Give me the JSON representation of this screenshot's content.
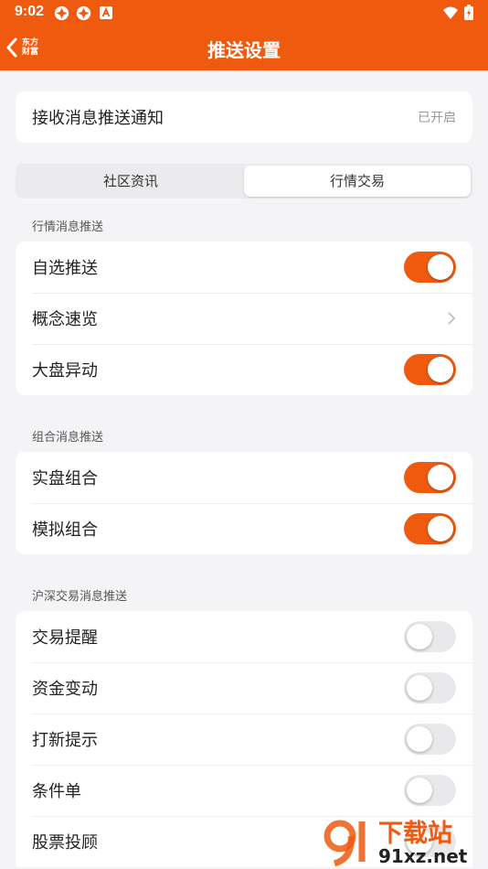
{
  "status_bar": {
    "time": "9:02"
  },
  "nav": {
    "back_logo_line1": "东方",
    "back_logo_line2": "财富",
    "title": "推送设置"
  },
  "receive": {
    "label": "接收消息推送通知",
    "value": "已开启"
  },
  "tabs": [
    {
      "label": "社区资讯",
      "active": false
    },
    {
      "label": "行情交易",
      "active": true
    }
  ],
  "sections": [
    {
      "title": "行情消息推送",
      "rows": [
        {
          "label": "自选推送",
          "control": "toggle",
          "on": true
        },
        {
          "label": "概念速览",
          "control": "chevron"
        },
        {
          "label": "大盘异动",
          "control": "toggle",
          "on": true
        }
      ]
    },
    {
      "title": "组合消息推送",
      "rows": [
        {
          "label": "实盘组合",
          "control": "toggle",
          "on": true
        },
        {
          "label": "模拟组合",
          "control": "toggle",
          "on": true
        }
      ]
    },
    {
      "title": "沪深交易消息推送",
      "rows": [
        {
          "label": "交易提醒",
          "control": "toggle",
          "on": false
        },
        {
          "label": "资金变动",
          "control": "toggle",
          "on": false
        },
        {
          "label": "打新提示",
          "control": "toggle",
          "on": false
        },
        {
          "label": "条件单",
          "control": "toggle",
          "on": false
        },
        {
          "label": "股票投顾",
          "control": "toggle",
          "on": false
        }
      ]
    }
  ],
  "watermark": {
    "text1": "下载站",
    "text2": "91xz.net"
  },
  "colors": {
    "accent": "#ef5a0f",
    "toggle_off": "#e9e9eb"
  }
}
